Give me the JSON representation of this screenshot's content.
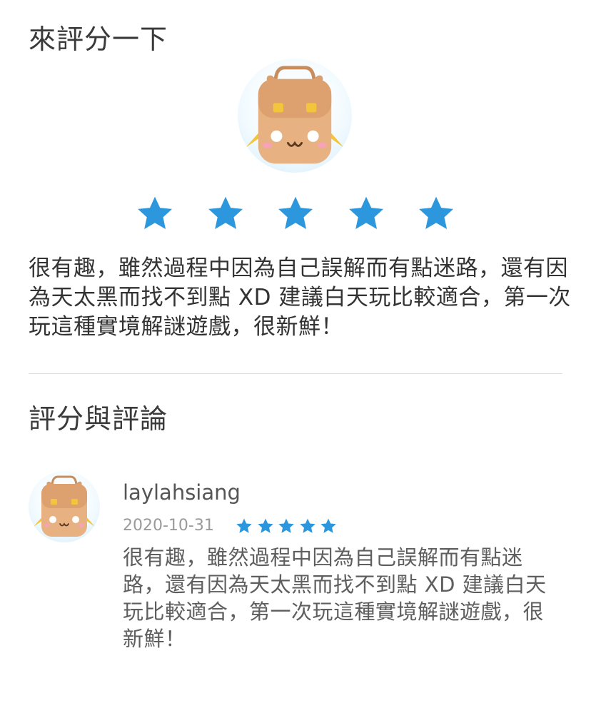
{
  "rate_section": {
    "title": "來評分一下",
    "avatar_icon": "backpack-mascot-icon",
    "rating": 5,
    "rating_max": 5,
    "review_text": "很有趣，雖然過程中因為自己誤解而有點迷路，還有因為天太黑而找不到點 XD 建議白天玩比較適合，第一次玩這種實境解謎遊戲，很新鮮！"
  },
  "reviews_section": {
    "title": "評分與評論",
    "reviews": [
      {
        "avatar_icon": "backpack-mascot-icon",
        "username": "laylahsiang",
        "date": "2020-10-31",
        "rating": 5,
        "rating_max": 5,
        "text": "很有趣，雖然過程中因為自己誤解而有點迷路，還有因為天太黑而找不到點 XD 建議白天玩比較適合，第一次玩這種實境解謎遊戲，很新鮮！"
      }
    ]
  },
  "colors": {
    "star": "#2c97dd",
    "title": "#3a3a3a",
    "body_text": "#333333",
    "muted_text": "#9a9a9a",
    "divider": "#dedede"
  }
}
